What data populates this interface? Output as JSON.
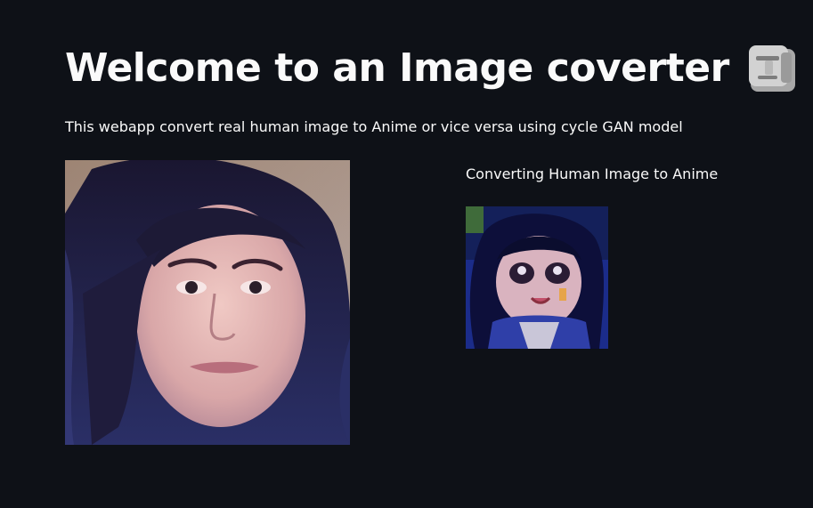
{
  "header": {
    "title": "Welcome to an Image coverter",
    "title_icon": "moai-icon"
  },
  "description": "This webapp convert real human image to Anime or vice versa using cycle GAN model",
  "images": {
    "input": {
      "icon": "human-face-photo"
    },
    "output": {
      "caption": "Converting Human Image to Anime",
      "icon": "anime-face-image"
    }
  },
  "colors": {
    "background": "#0e1117",
    "text": "#fafafa"
  }
}
